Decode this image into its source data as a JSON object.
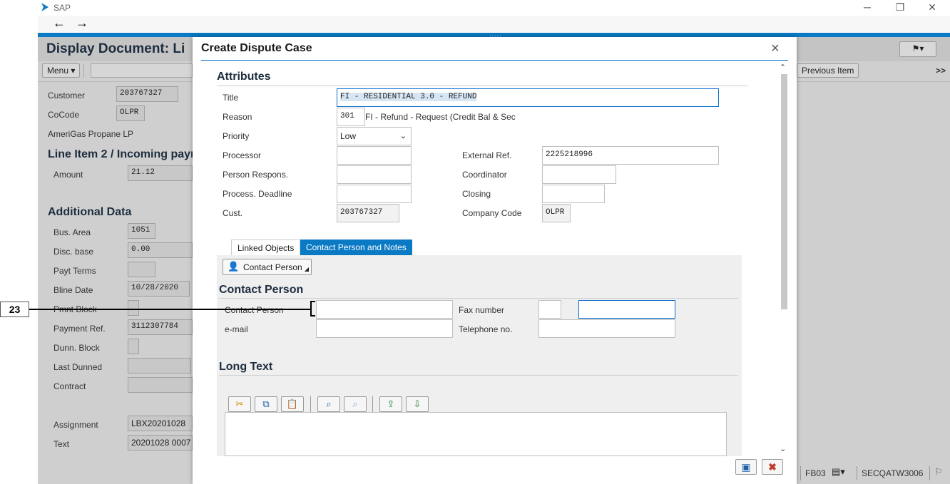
{
  "window": {
    "app_title": "SAP",
    "minimize": "─",
    "restore": "❐",
    "close": "✕",
    "back": "←",
    "forward": "→",
    "grip": "....."
  },
  "background": {
    "page_title": "Display Document: Li",
    "menu_label": "Menu",
    "previous_item_label": "Previous Item",
    "expand_label": ">>",
    "customer": {
      "label": "Customer",
      "value": "203767327"
    },
    "cocode": {
      "label": "CoCode",
      "value": "OLPR"
    },
    "company_name": "AmeriGas Propane LP",
    "line_item_heading": "Line Item 2 / Incoming payı",
    "amount": {
      "label": "Amount",
      "value": "21.12"
    },
    "additional_heading": "Additional Data",
    "fields": [
      {
        "label": "Bus. Area",
        "value": "1051"
      },
      {
        "label": "Disc. base",
        "value": "0.00"
      },
      {
        "label": "Payt Terms",
        "value": ""
      },
      {
        "label": "Bline Date",
        "value": "10/28/2020"
      },
      {
        "label": "Pmnt Block",
        "value": ""
      },
      {
        "label": "Payment Ref.",
        "value": "3112307784"
      },
      {
        "label": "Dunn. Block",
        "value": ""
      },
      {
        "label": "Last Dunned",
        "value": ""
      },
      {
        "label": "Contract",
        "value": ""
      }
    ],
    "assignment": {
      "label": "Assignment",
      "value": "LBX20201028"
    },
    "text": {
      "label": "Text",
      "value": "20201028 0007"
    }
  },
  "annotation": {
    "number": "23"
  },
  "modal": {
    "title": "Create Dispute Case",
    "close": "×",
    "attributes_heading": "Attributes",
    "title_field": {
      "label": "Title",
      "value": "FI - RESIDENTIAL 3.0 - REFUND"
    },
    "reason": {
      "label": "Reason",
      "code": "301",
      "description": "FI - Refund - Request (Credit Bal & Sec"
    },
    "priority": {
      "label": "Priority",
      "value": "Low"
    },
    "processor": {
      "label": "Processor",
      "value": ""
    },
    "person_respons": {
      "label": "Person Respons.",
      "value": ""
    },
    "process_deadline": {
      "label": "Process. Deadline",
      "value": ""
    },
    "cust": {
      "label": "Cust.",
      "value": "203767327"
    },
    "external_ref": {
      "label": "External Ref.",
      "value": "2225218996"
    },
    "coordinator": {
      "label": "Coordinator",
      "value": ""
    },
    "closing": {
      "label": "Closing",
      "value": ""
    },
    "company_code": {
      "label": "Company Code",
      "value": "OLPR"
    },
    "tabs": [
      {
        "label": "Linked Objects",
        "active": false
      },
      {
        "label": "Contact Person and Notes",
        "active": true
      }
    ],
    "contact_person_button": "Contact Person",
    "contact_heading": "Contact Person",
    "contact_person": {
      "label": "Contact Person",
      "value": ""
    },
    "email": {
      "label": "e-mail",
      "value": ""
    },
    "fax": {
      "label": "Fax number",
      "value": ""
    },
    "telephone": {
      "label": "Telephone no.",
      "value": ""
    },
    "long_text_heading": "Long Text",
    "long_text_value": ""
  },
  "status_bar": {
    "transaction": "FB03",
    "system": "SECQATW3006"
  },
  "colors": {
    "accent": "#0a7ac4",
    "save": "#1f5fa8",
    "cancel": "#c0392b"
  }
}
